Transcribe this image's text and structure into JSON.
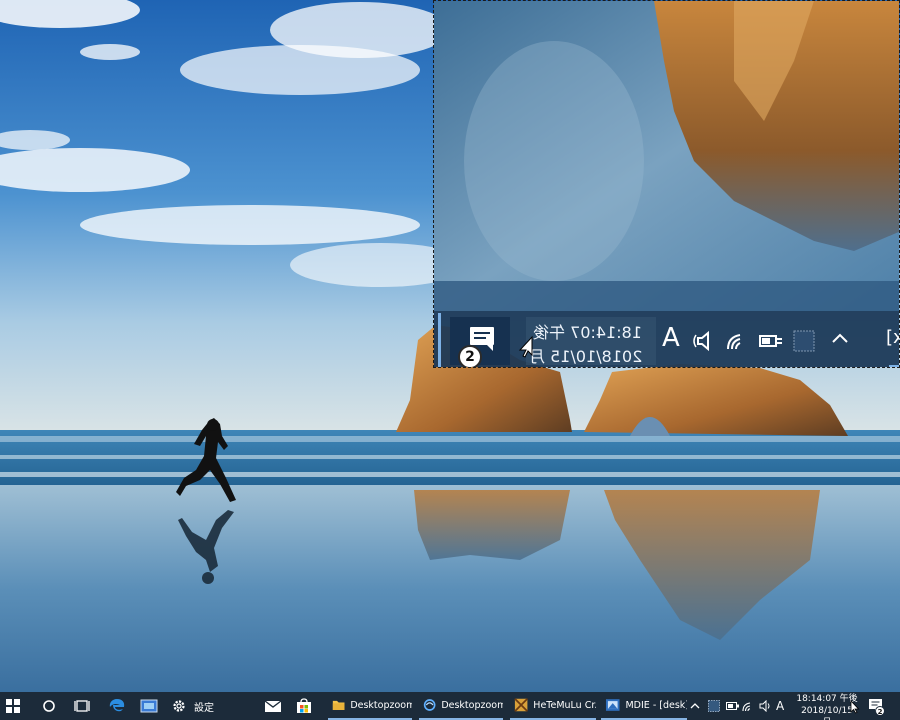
{
  "taskbar": {
    "start": {
      "icon": "windows-logo-icon"
    },
    "cortana": {
      "icon": "cortana-circle-icon"
    },
    "task_view": {
      "icon": "task-view-icon"
    },
    "pinned": [
      {
        "name": "edge",
        "icon": "edge-icon"
      },
      {
        "name": "screenshot-tool",
        "icon": "screenshot-tool-icon"
      }
    ],
    "settings": {
      "label": "設定",
      "icon": "gear-icon"
    },
    "mail": {
      "icon": "mail-icon"
    },
    "store": {
      "icon": "store-icon"
    },
    "apps": [
      {
        "label": "Desktopzoom...",
        "icon": "folder-icon"
      },
      {
        "label": "Desktopzoom...",
        "icon": "desktopzoom-app-icon"
      },
      {
        "label": "HeTeMuLu Cr...",
        "icon": "hetemulu-app-icon"
      },
      {
        "label": "MDIE - [desk]",
        "icon": "mdie-app-icon"
      }
    ],
    "tray": {
      "chevron_icon": "chevron-up-icon",
      "ime": "A",
      "time": "18:14:07 午後",
      "date": "2018/10/15 月",
      "notifications_count": "2"
    }
  },
  "zoom_view": {
    "time": "18:14:07 午後",
    "date": "2018/10/15 月",
    "ime": "A",
    "notifications_count": "2",
    "edge_glyph": "[x"
  },
  "colors": {
    "taskbar_bg": "#1c2b3a",
    "active_underline": "#86b4e4",
    "zoom_bar_bg": "#1a3756",
    "sky": "#2c6fb8"
  }
}
